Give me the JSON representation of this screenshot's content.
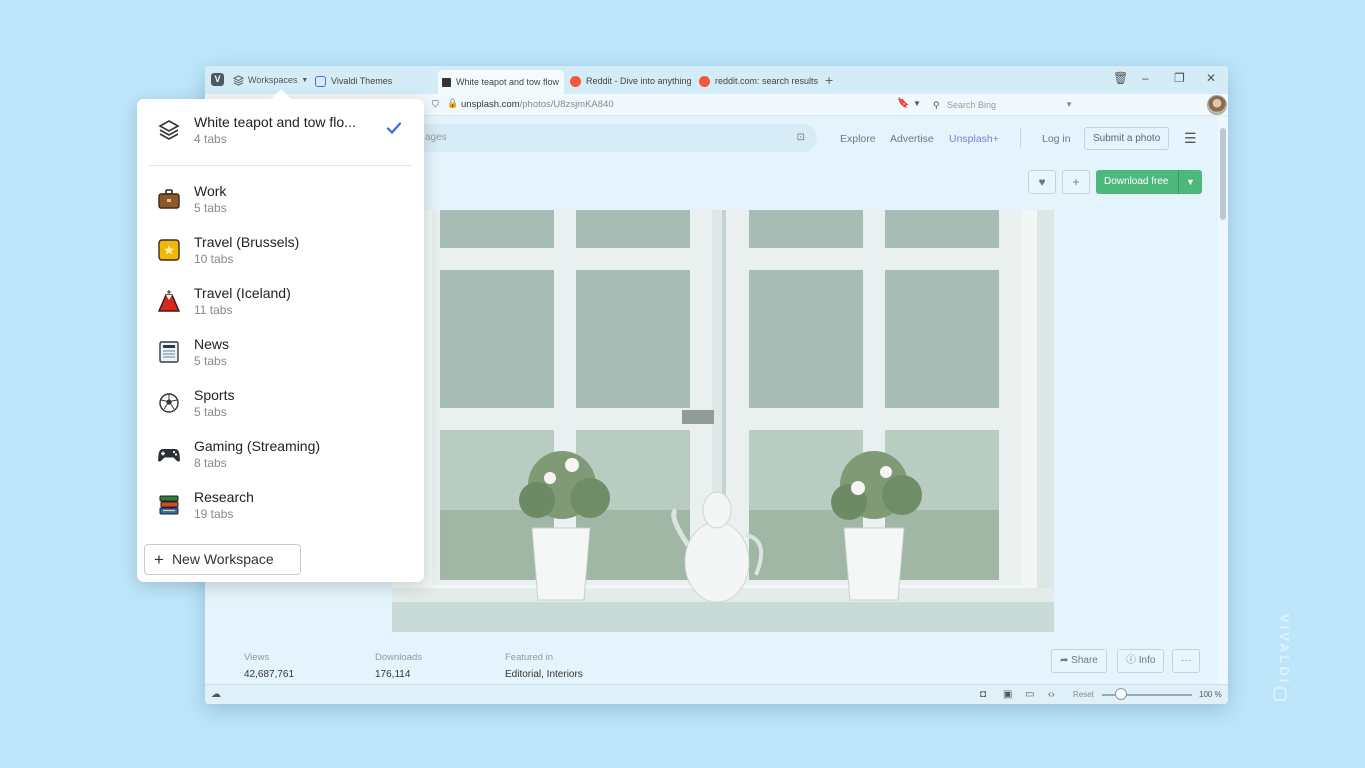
{
  "browser": {
    "workspaces_label": "Workspaces",
    "tabs": [
      {
        "title": "Vivaldi Themes",
        "favicon": "vivaldi-icon"
      },
      {
        "title": "White teapot and tow flow",
        "favicon": "unsplash-icon",
        "active": true
      },
      {
        "title": "Reddit - Dive into anything",
        "favicon": "reddit-icon"
      },
      {
        "title": "reddit.com: search results -",
        "favicon": "reddit-icon"
      }
    ],
    "new_tab_label": "+",
    "address": {
      "host": "unsplash.com",
      "path": "/photos/U8zsjmKA840"
    },
    "search_placeholder": "Search Bing"
  },
  "site": {
    "search_placeholder": "ages",
    "nav": {
      "explore": "Explore",
      "advertise": "Advertise",
      "unsplash_plus": "Unsplash+",
      "login": "Log in",
      "submit": "Submit a photo"
    },
    "download_label": "Download free",
    "stats": {
      "views_label": "Views",
      "views_value": "42,687,761",
      "downloads_label": "Downloads",
      "downloads_value": "176,114",
      "featured_label": "Featured in",
      "featured_value": "Editorial, Interiors"
    },
    "share_label": "Share",
    "info_label": "Info",
    "more_label": "···"
  },
  "status_bar": {
    "reset_label": "Reset",
    "zoom_value": "100 %"
  },
  "workspace_popup": {
    "current": {
      "name": "White teapot and tow flo...",
      "tabs": "4 tabs",
      "icon": "layers-icon"
    },
    "items": [
      {
        "name": "Work",
        "tabs": "5 tabs",
        "icon": "briefcase-icon"
      },
      {
        "name": "Travel (Brussels)",
        "tabs": "10 tabs",
        "icon": "belgium-flag-icon"
      },
      {
        "name": "Travel (Iceland)",
        "tabs": "11 tabs",
        "icon": "volcano-icon"
      },
      {
        "name": "News",
        "tabs": "5 tabs",
        "icon": "newspaper-icon"
      },
      {
        "name": "Sports",
        "tabs": "5 tabs",
        "icon": "soccer-ball-icon"
      },
      {
        "name": "Gaming (Streaming)",
        "tabs": "8 tabs",
        "icon": "gamepad-icon"
      },
      {
        "name": "Research",
        "tabs": "19 tabs",
        "icon": "books-icon"
      }
    ],
    "new_workspace_label": "New Workspace"
  },
  "brand_text": "VIVALDI",
  "colors": {
    "background": "#bde6fb",
    "download_button": "#4cb87c",
    "check": "#3b6fd8",
    "unsplash_plus": "#7a7fd6"
  }
}
